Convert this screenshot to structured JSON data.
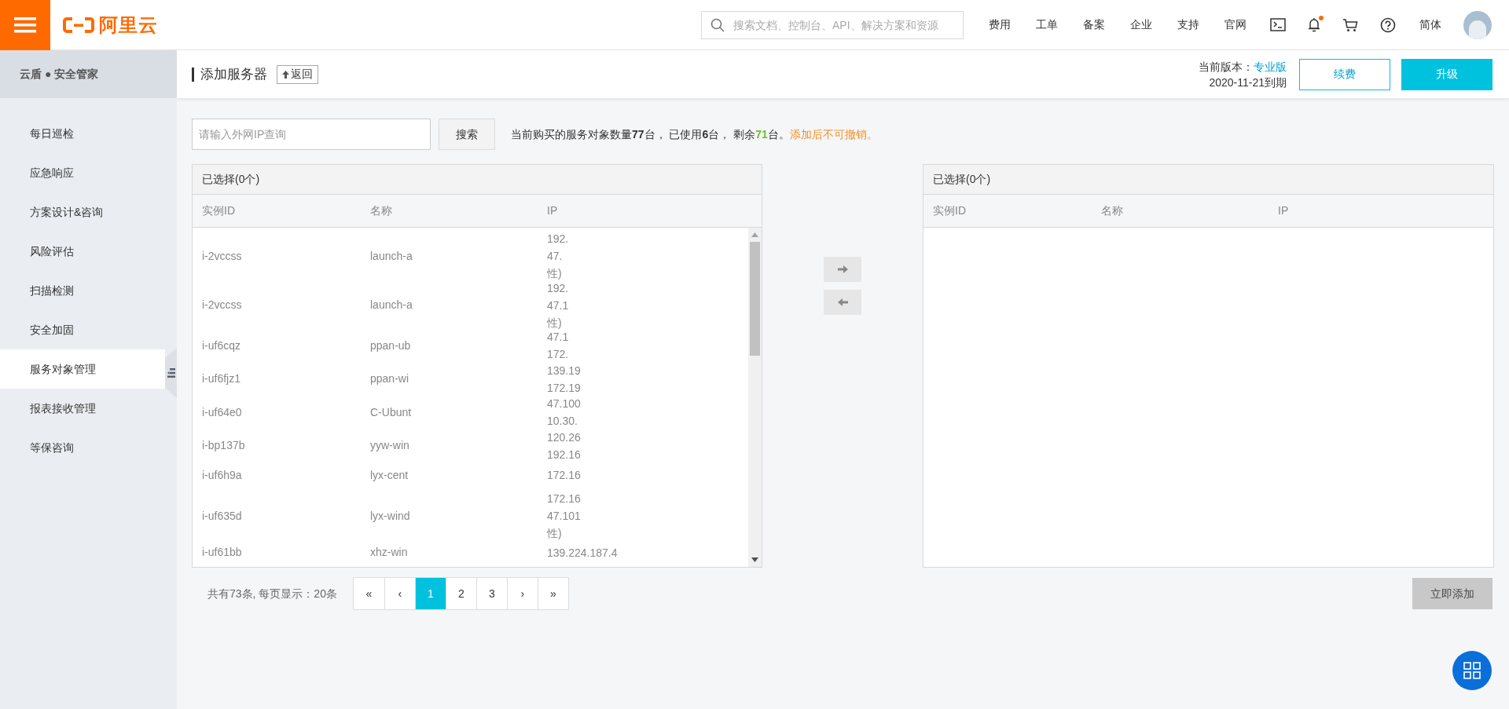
{
  "topbar": {
    "logo": "阿里云",
    "search": {
      "placeholder": "搜索文档、控制台、API、解决方案和资源"
    },
    "nav": [
      "费用",
      "工单",
      "备案",
      "企业",
      "支持",
      "官网"
    ],
    "notification_dot": true,
    "language": "简体"
  },
  "sidebar": {
    "title": "云盾 ● 安全管家",
    "items": [
      {
        "label": "每日巡检",
        "selected": false
      },
      {
        "label": "应急响应",
        "selected": false
      },
      {
        "label": "方案设计&咨询",
        "selected": false
      },
      {
        "label": "风险评估",
        "selected": false
      },
      {
        "label": "扫描检测",
        "selected": false
      },
      {
        "label": "安全加固",
        "selected": false
      },
      {
        "label": "服务对象管理",
        "selected": true
      },
      {
        "label": "报表接收管理",
        "selected": false
      },
      {
        "label": "等保咨询",
        "selected": false
      }
    ]
  },
  "header": {
    "title": "添加服务器",
    "back": "返回",
    "version_label": "当前版本：",
    "version": "专业版",
    "expiry": "2020-11-21到期",
    "renew": "续费",
    "upgrade": "升级"
  },
  "search": {
    "placeholder": "请输入外网IP查询",
    "button": "搜索"
  },
  "quota": [
    {
      "kind": "plain",
      "text": "当前购买的服务对象数量"
    },
    {
      "kind": "strong",
      "text": "77"
    },
    {
      "kind": "plain",
      "text": "台， 已使用"
    },
    {
      "kind": "strong",
      "text": "6"
    },
    {
      "kind": "plain",
      "text": "台， 剩余"
    },
    {
      "kind": "success",
      "text": "71"
    },
    {
      "kind": "plain",
      "text": "台。"
    },
    {
      "kind": "warning",
      "text": "添加后不可撤销。"
    }
  ],
  "left_table": {
    "title": "已选择(0个)",
    "columns": [
      "实例ID",
      "名称",
      "IP"
    ],
    "rows": [
      {
        "id": "i-2vccss",
        "name": "launch-a",
        "ip": [
          "192.",
          "47.",
          "性)"
        ]
      },
      {
        "id": "i-2vccss",
        "name": "launch-a",
        "ip": [
          "192.",
          "47.1",
          "性)"
        ]
      },
      {
        "id": "i-uf6cqz",
        "name": "ppan-ub",
        "ip": [
          "47.1",
          "172."
        ]
      },
      {
        "id": "i-uf6fjz1",
        "name": "ppan-wi",
        "ip": [
          "139.19",
          "172.19"
        ]
      },
      {
        "id": "i-uf64e0",
        "name": "C-Ubunt",
        "ip": [
          "47.100",
          "10.30."
        ]
      },
      {
        "id": "i-bp137b",
        "name": "yyw-win",
        "ip": [
          "120.26",
          "192.16"
        ]
      },
      {
        "id": "i-uf6h9a",
        "name": "lyx-cent",
        "ip": [
          "172.16"
        ]
      },
      {
        "id": "i-uf635d",
        "name": "lyx-wind",
        "ip": [
          "172.16",
          "47.101",
          "性)"
        ]
      },
      {
        "id": "i-uf61bb",
        "name": "xhz-win",
        "ip": [
          "139.224.187.4"
        ]
      }
    ]
  },
  "right_table": {
    "title": "已选择(0个)",
    "columns": [
      "实例ID",
      "名称",
      "IP"
    ]
  },
  "pagination": {
    "summary": "共有73条, 每页显示：20条",
    "pages": [
      {
        "label": "«",
        "selected": false
      },
      {
        "label": "‹",
        "selected": false
      },
      {
        "label": "1",
        "selected": true
      },
      {
        "label": "2",
        "selected": false
      },
      {
        "label": "3",
        "selected": false
      },
      {
        "label": "›",
        "selected": false
      },
      {
        "label": "»",
        "selected": false
      }
    ]
  },
  "add_button": {
    "label": "立即添加",
    "disabled": true
  }
}
